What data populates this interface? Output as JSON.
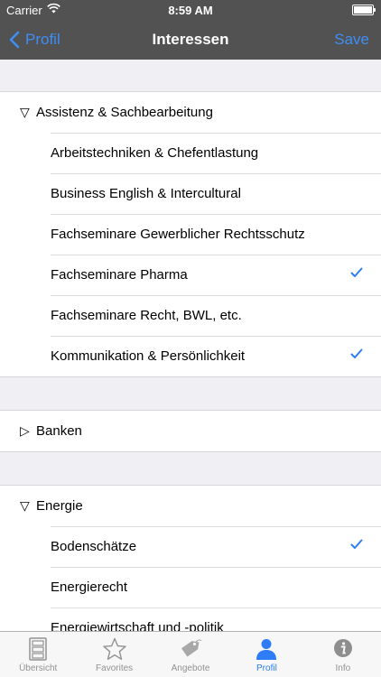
{
  "status": {
    "carrier": "Carrier",
    "time": "8:59 AM"
  },
  "nav": {
    "back_label": "Profil",
    "title": "Interessen",
    "save_label": "Save"
  },
  "groups": [
    {
      "header": "Assistenz & Sachbearbeitung",
      "expanded": true,
      "items": [
        {
          "label": "Arbeitstechniken & Chefentlastung",
          "checked": false
        },
        {
          "label": "Business English & Intercultural",
          "checked": false
        },
        {
          "label": "Fachseminare Gewerblicher Rechtsschutz",
          "checked": false
        },
        {
          "label": "Fachseminare Pharma",
          "checked": true
        },
        {
          "label": "Fachseminare Recht, BWL, etc.",
          "checked": false
        },
        {
          "label": "Kommunikation & Persönlichkeit",
          "checked": true
        }
      ]
    },
    {
      "header": "Banken",
      "expanded": false,
      "items": []
    },
    {
      "header": "Energie",
      "expanded": true,
      "items": [
        {
          "label": "Bodenschätze",
          "checked": true
        },
        {
          "label": "Energierecht",
          "checked": false
        },
        {
          "label": "Energiewirtschaft und -politik",
          "checked": false
        }
      ]
    }
  ],
  "tabs": [
    {
      "label": "Übersicht",
      "icon": "cabinet-icon",
      "active": false
    },
    {
      "label": "Favorites",
      "icon": "star-icon",
      "active": false
    },
    {
      "label": "Angebote",
      "icon": "tag-icon",
      "active": false
    },
    {
      "label": "Profil",
      "icon": "person-icon",
      "active": true
    },
    {
      "label": "Info",
      "icon": "info-icon",
      "active": false
    }
  ],
  "colors": {
    "accent": "#2f7df6",
    "bar": "#525252",
    "background": "#efeff4"
  }
}
